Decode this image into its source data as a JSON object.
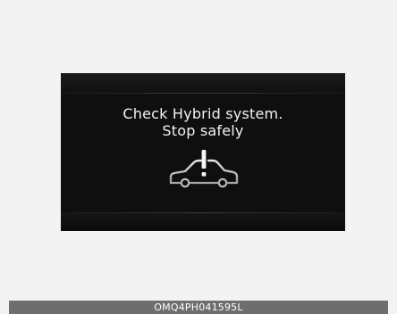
{
  "display": {
    "message_line1": "Check Hybrid system.",
    "message_line2": "Stop safely",
    "icon": "car-warning-icon"
  },
  "caption": {
    "code": "OMQ4PH041595L"
  },
  "colors": {
    "page_background": "#f3f3f3",
    "display_background": "#0f0f0f",
    "text": "#f2f2f2",
    "caption_bar": "#6e6e6e"
  }
}
